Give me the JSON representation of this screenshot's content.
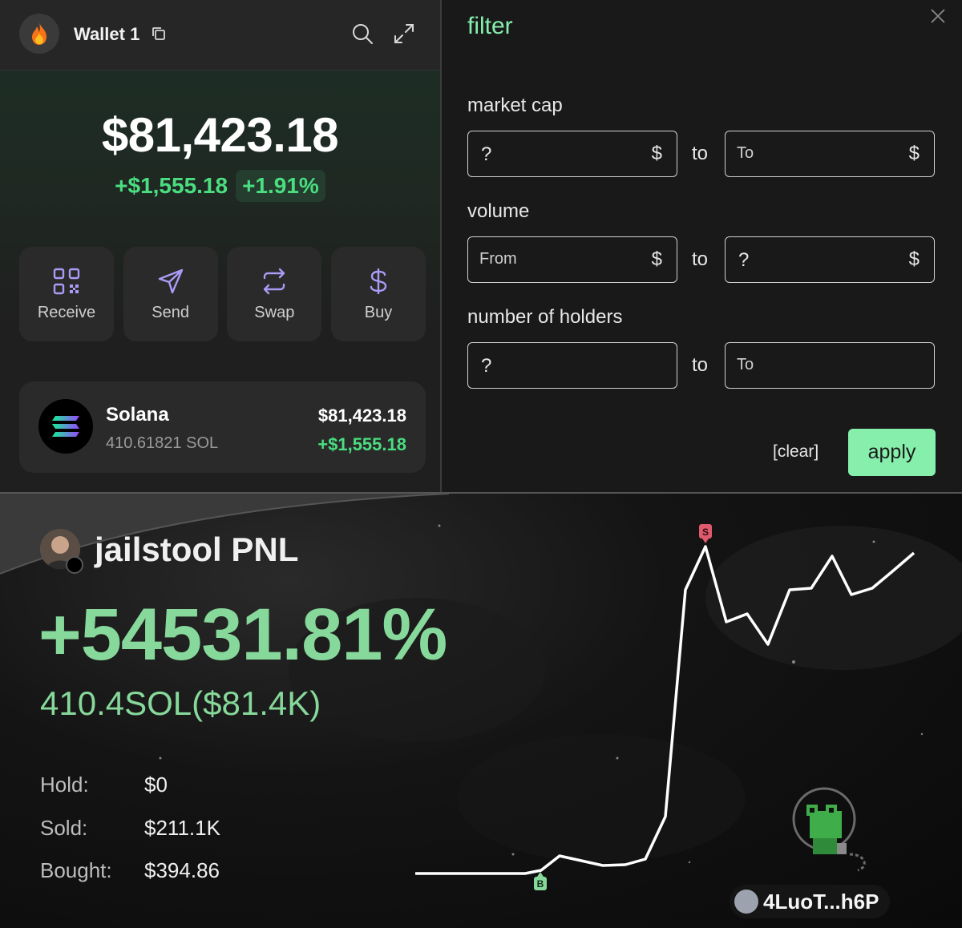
{
  "wallet": {
    "name": "Wallet 1",
    "balance": "$81,423.18",
    "change_abs": "+$1,555.18",
    "change_pct": "+1.91%",
    "actions": [
      {
        "label": "Receive",
        "icon": "qr-code-icon"
      },
      {
        "label": "Send",
        "icon": "send-icon"
      },
      {
        "label": "Swap",
        "icon": "swap-icon"
      },
      {
        "label": "Buy",
        "icon": "dollar-icon"
      }
    ],
    "token": {
      "name": "Solana",
      "amount": "410.61821 SOL",
      "value": "$81,423.18",
      "change": "+$1,555.18"
    }
  },
  "filter": {
    "title": "filter",
    "groups": [
      {
        "label": "market cap",
        "from_placeholder": "?",
        "to_placeholder": "To",
        "currency": "$",
        "to_word": "to"
      },
      {
        "label": "volume",
        "from_placeholder": "From",
        "to_placeholder": "?",
        "currency": "$",
        "to_word": "to"
      },
      {
        "label": "number of holders",
        "from_placeholder": "?",
        "to_placeholder": "To",
        "currency": "",
        "to_word": "to"
      }
    ],
    "clear_label": "[clear]",
    "apply_label": "apply"
  },
  "pnl": {
    "user": "jailstool PNL",
    "percent": "+54531.81%",
    "sol_summary": "410.4SOL($81.4K)",
    "stats": [
      {
        "label": "Hold:",
        "value": "$0"
      },
      {
        "label": "Sold:",
        "value": "$211.1K"
      },
      {
        "label": "Bought:",
        "value": "$394.86"
      }
    ],
    "address": "4LuoT...h6P",
    "markers": {
      "buy": "B",
      "sell": "S"
    }
  },
  "colors": {
    "accent_green": "#86efac",
    "positive": "#4ade80",
    "pnl_green": "#86d99a",
    "sell_marker": "#e05a6d"
  }
}
